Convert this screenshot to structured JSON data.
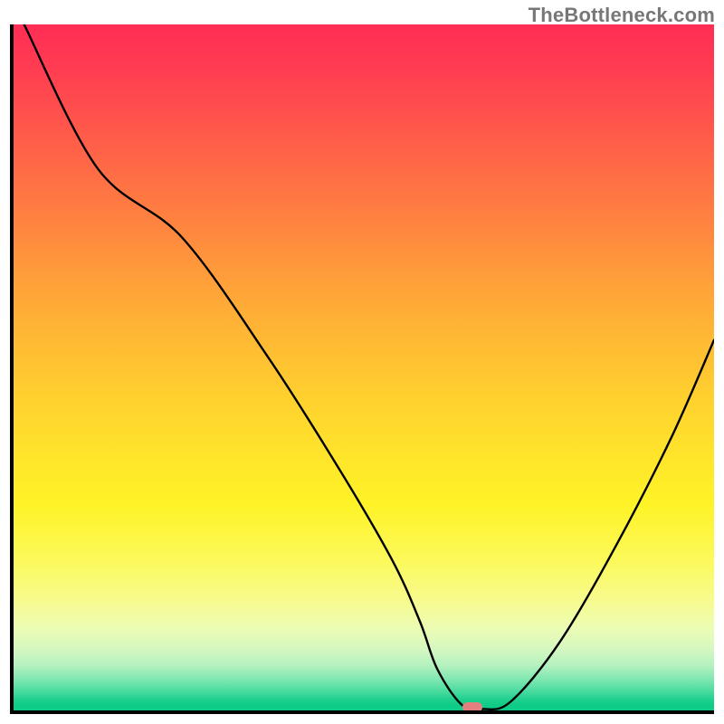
{
  "watermark": "TheBottleneck.com",
  "chart_data": {
    "type": "line",
    "title": "",
    "xlabel": "",
    "ylabel": "",
    "x_range": [
      0,
      100
    ],
    "y_range": [
      0,
      100
    ],
    "series": [
      {
        "name": "bottleneck-curve",
        "x": [
          1.5,
          12,
          24,
          36,
          46,
          54,
          58,
          60.5,
          64,
          67,
          71,
          78,
          86,
          94,
          100
        ],
        "y": [
          100,
          79,
          69,
          52,
          36,
          22,
          13,
          6,
          0.8,
          0.2,
          1.3,
          10,
          24,
          40,
          54
        ]
      }
    ],
    "marker": {
      "x": 65.5,
      "y": 0.4
    },
    "background_gradient": {
      "top": "#ff2d55",
      "mid": "#ffe72a",
      "bottom": "#0cce89"
    }
  }
}
